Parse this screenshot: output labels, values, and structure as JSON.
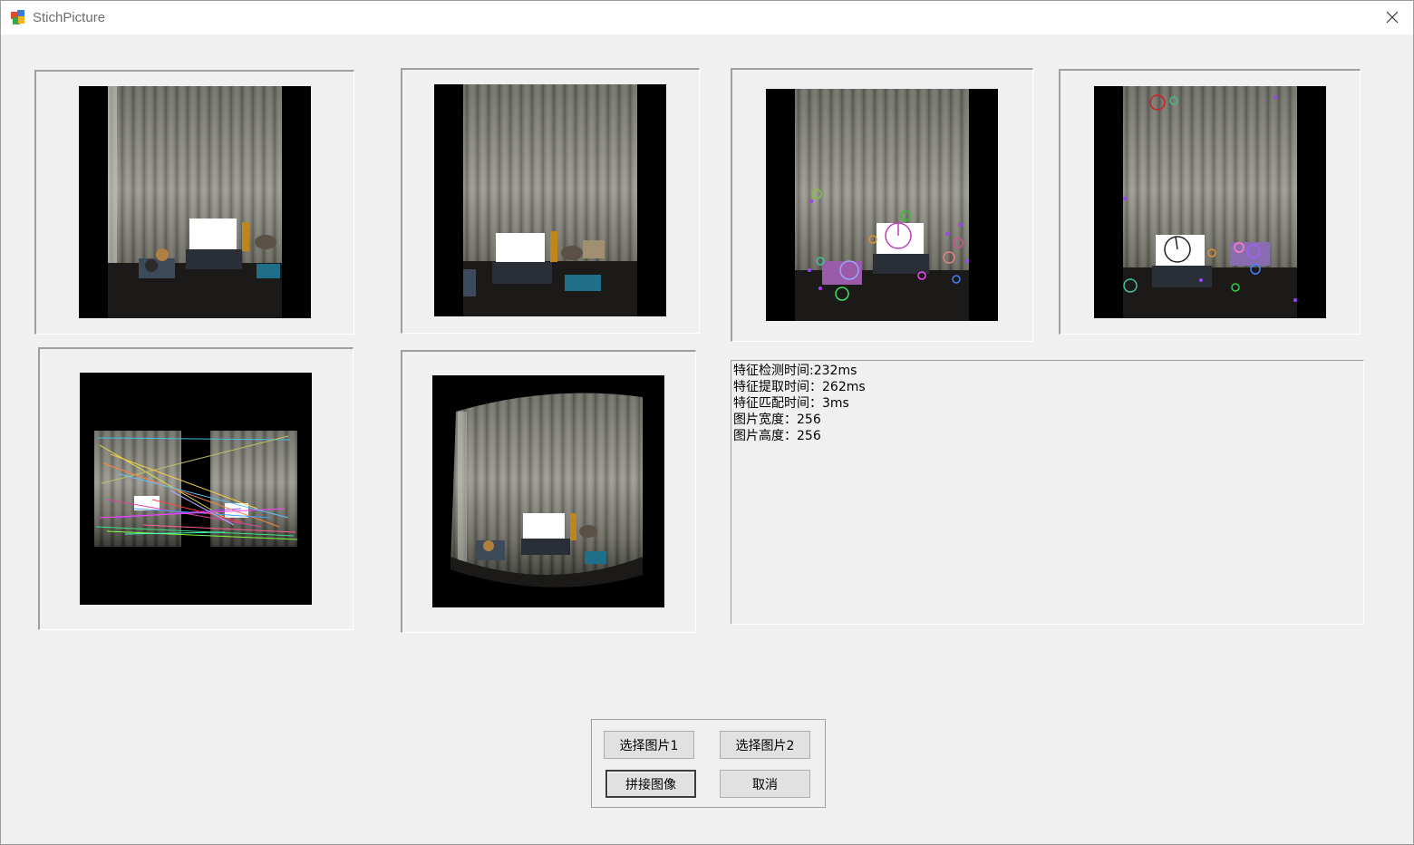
{
  "window": {
    "title": "StichPicture"
  },
  "info": {
    "lines": [
      "特征检测时间:232ms",
      "特征提取时间：262ms",
      "特征匹配时间：3ms",
      "图片宽度：256",
      "图片高度：256"
    ]
  },
  "buttons": {
    "select_image_1": "选择图片1",
    "select_image_2": "选择图片2",
    "stitch": "拼接图像",
    "cancel": "取消"
  },
  "colors": {
    "window_bg": "#f0f0f0",
    "titlebar_bg": "#ffffff",
    "image_bg": "#000000",
    "curtain": "#8a8a80"
  },
  "icons": {
    "app": "app-icon",
    "close": "close-icon"
  }
}
